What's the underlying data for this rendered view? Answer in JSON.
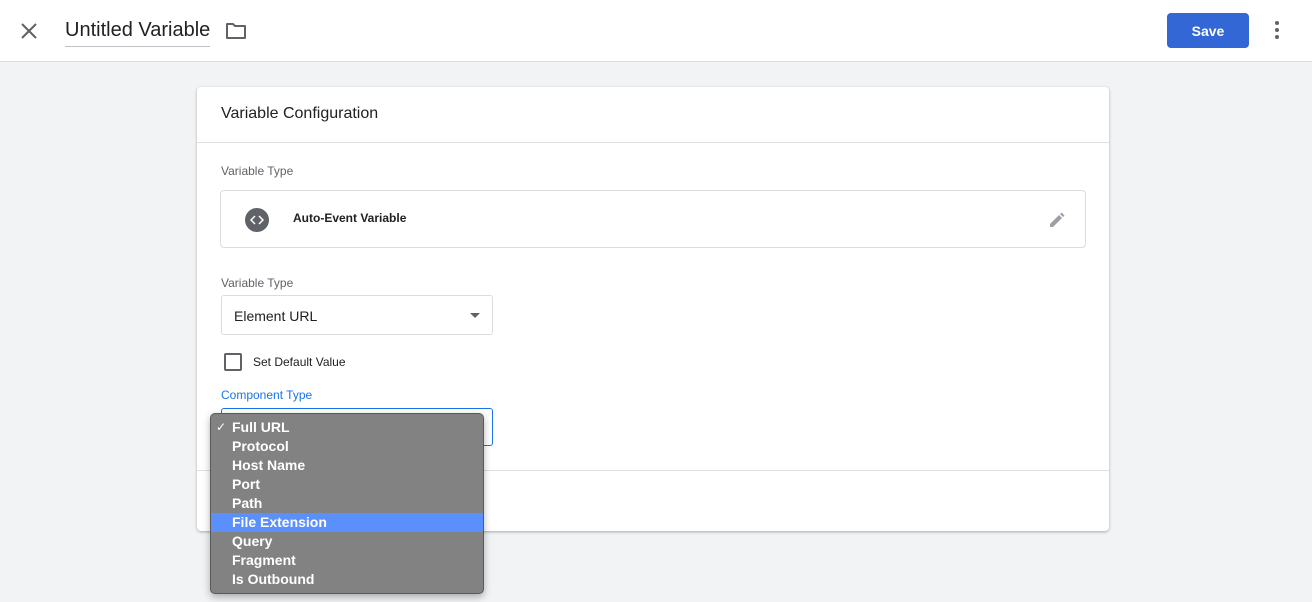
{
  "header": {
    "title": "Untitled Variable",
    "save_label": "Save"
  },
  "card": {
    "title": "Variable Configuration",
    "variable_type_label": "Variable Type",
    "variable_type_name": "Auto-Event Variable",
    "sub_type_label": "Variable Type",
    "sub_type_value": "Element URL",
    "default_value_label": "Set Default Value",
    "component_type_label": "Component Type"
  },
  "dropdown": {
    "selected": "Full URL",
    "highlighted": "File Extension",
    "options": [
      {
        "label": "Full URL"
      },
      {
        "label": "Protocol"
      },
      {
        "label": "Host Name"
      },
      {
        "label": "Port"
      },
      {
        "label": "Path"
      },
      {
        "label": "File Extension"
      },
      {
        "label": "Query"
      },
      {
        "label": "Fragment"
      },
      {
        "label": "Is Outbound"
      }
    ]
  },
  "icons": {
    "close": "close-icon",
    "folder": "folder-icon",
    "more": "more-vert-icon",
    "variable_type": "code-icon",
    "edit": "pencil-icon"
  },
  "colors": {
    "accent": "#3367d6",
    "focus": "#1a73e8",
    "dropdown_bg": "#828282",
    "dropdown_highlight": "#5b8ffc"
  }
}
